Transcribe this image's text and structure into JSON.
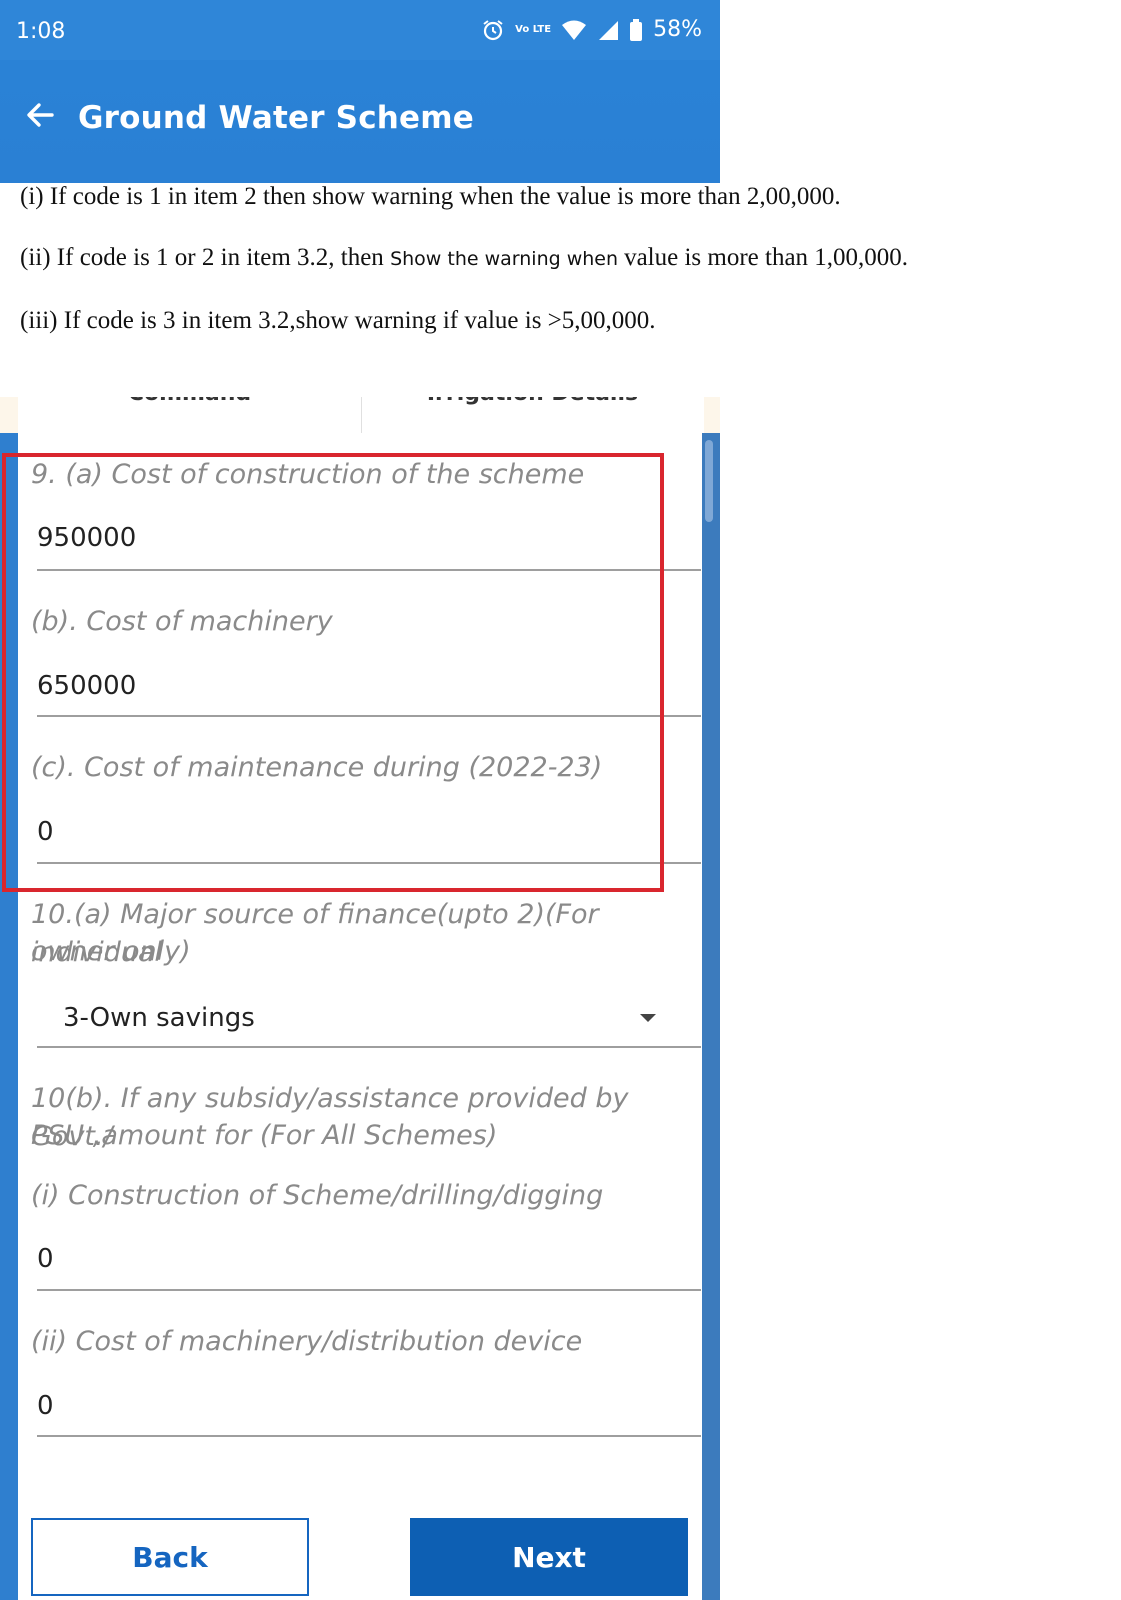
{
  "status_bar": {
    "time": "1:08",
    "network": "Vo LTE",
    "battery": "58%"
  },
  "app_bar": {
    "title": "Ground Water Scheme",
    "back_icon": "arrow-left-icon"
  },
  "notes": {
    "note1": "(i) If code is 1 in item 2 then show warning when the value is more than 2,00,000.",
    "note2_a": "(ii) If code is 1 or 2 in item 3.2, then ",
    "note2_b": "Show the warning  when ",
    "note2_c": " value is more than 1,00,000.",
    "note3": "(iii) If code is 3 in item 3.2,show warning  if value is >5,00,000."
  },
  "tabs": {
    "left": "Command",
    "right": "Irrigation Details"
  },
  "form": {
    "q9a_label": "9. (a) Cost of construction of the scheme",
    "q9a_value": "950000",
    "q9b_label": "(b). Cost of machinery",
    "q9b_value": "650000",
    "q9c_label": "(c). Cost of maintenance during (2022-23)",
    "q9c_value": "0",
    "q10a_label_line1": "10.(a) Major source of finance(upto 2)(For individual",
    "q10a_label_line2": "owner only)",
    "q10a_value": "3-Own savings",
    "q10b_label_line1": "10(b). If any subsidy/assistance provided by Govt./",
    "q10b_label_line2": "PSU ,amount for (For All Schemes)",
    "q10b_i_label": "(i) Construction of Scheme/drilling/digging",
    "q10b_i_value": "0",
    "q10b_ii_label": "(ii) Cost of machinery/distribution device",
    "q10b_ii_value": "0"
  },
  "buttons": {
    "back": "Back",
    "next": "Next"
  },
  "colors": {
    "app_bar": "#2a82d6",
    "primary_button": "#0d5fb3",
    "highlight_box": "#d9262e"
  }
}
